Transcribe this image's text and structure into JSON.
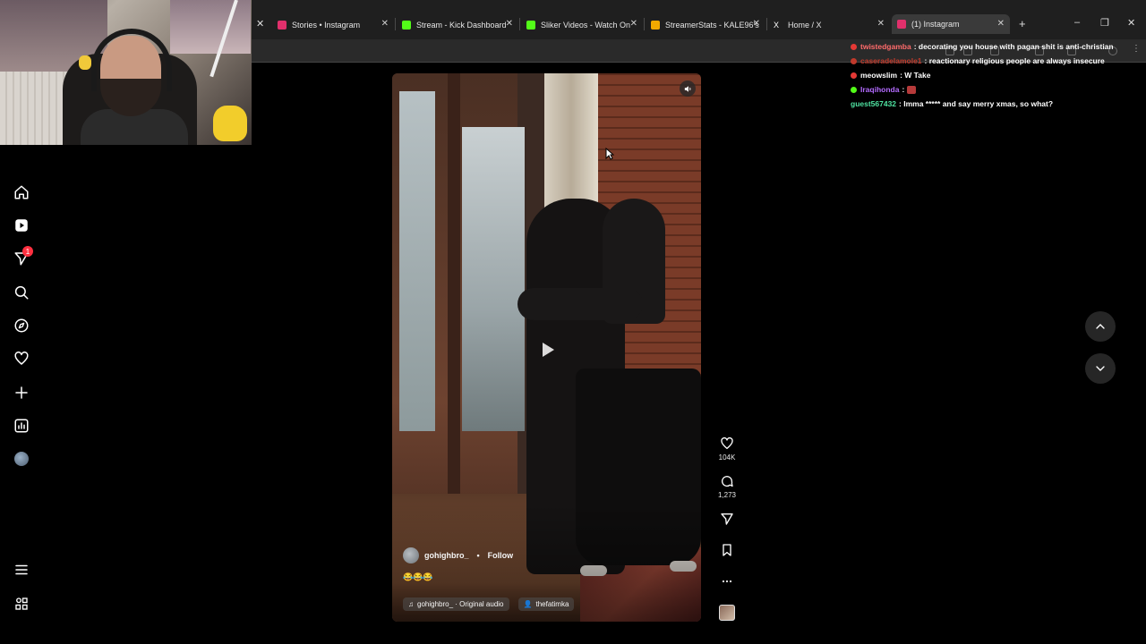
{
  "browser": {
    "tabs": [
      {
        "title": "Stories • Instagram",
        "icon_color": "#e1306c",
        "active": false
      },
      {
        "title": "Stream - Kick Dashboard",
        "icon_color": "#53fc18",
        "active": false
      },
      {
        "title": "Sliker Videos - Watch On",
        "icon_color": "#53fc18",
        "active": false
      },
      {
        "title": "StreamerStats - KALE96's",
        "icon_color": "#f2a900",
        "active": false
      },
      {
        "title": "Home / X",
        "icon_name": "x-logo-icon",
        "active": false
      },
      {
        "title": "(1) Instagram",
        "icon_color": "#e1306c",
        "active": true
      }
    ],
    "new_tab": "+",
    "close_glyph": "✕"
  },
  "sidebar": {
    "items": [
      {
        "name": "home-icon"
      },
      {
        "name": "reels-icon"
      },
      {
        "name": "messages-icon",
        "badge": "1"
      },
      {
        "name": "search-icon"
      },
      {
        "name": "explore-icon"
      },
      {
        "name": "notifications-icon"
      },
      {
        "name": "create-icon"
      },
      {
        "name": "dashboard-icon"
      },
      {
        "name": "profile-avatar"
      }
    ],
    "bottom": [
      {
        "name": "menu-icon"
      },
      {
        "name": "also-from-meta-icon"
      }
    ]
  },
  "reel": {
    "author": "gohighbro_",
    "separator": "•",
    "follow_label": "Follow",
    "caption": "😂😂😂",
    "audio": "gohighbro_ · Original audio",
    "tagged_user": "thefatimka",
    "likes": "104K",
    "comments": "1,273"
  },
  "chat": {
    "messages": [
      {
        "user": "twistedgamba",
        "text": ": decorating you house with pagan shit is anti-christian",
        "user_color": "#ff6b6b",
        "icon_color": "#e53935"
      },
      {
        "user": "caseradelamole1",
        "text": ": reactionary religious people are always insecure",
        "user_color": "#c0392b",
        "icon_color": "#c0392b"
      },
      {
        "user": "meowslim",
        "text": ": W Take",
        "user_color": "#ffffff",
        "icon_color": "#e53935"
      },
      {
        "user": "Iraqihonda",
        "text": ":",
        "user_color": "#b36bff",
        "icon_color": "#53fc18",
        "emote": true
      },
      {
        "user": "guest567432",
        "text": ": Imma ***** and say merry xmas, so what?",
        "user_color": "#4ee1a0",
        "icon_color": null
      }
    ]
  }
}
